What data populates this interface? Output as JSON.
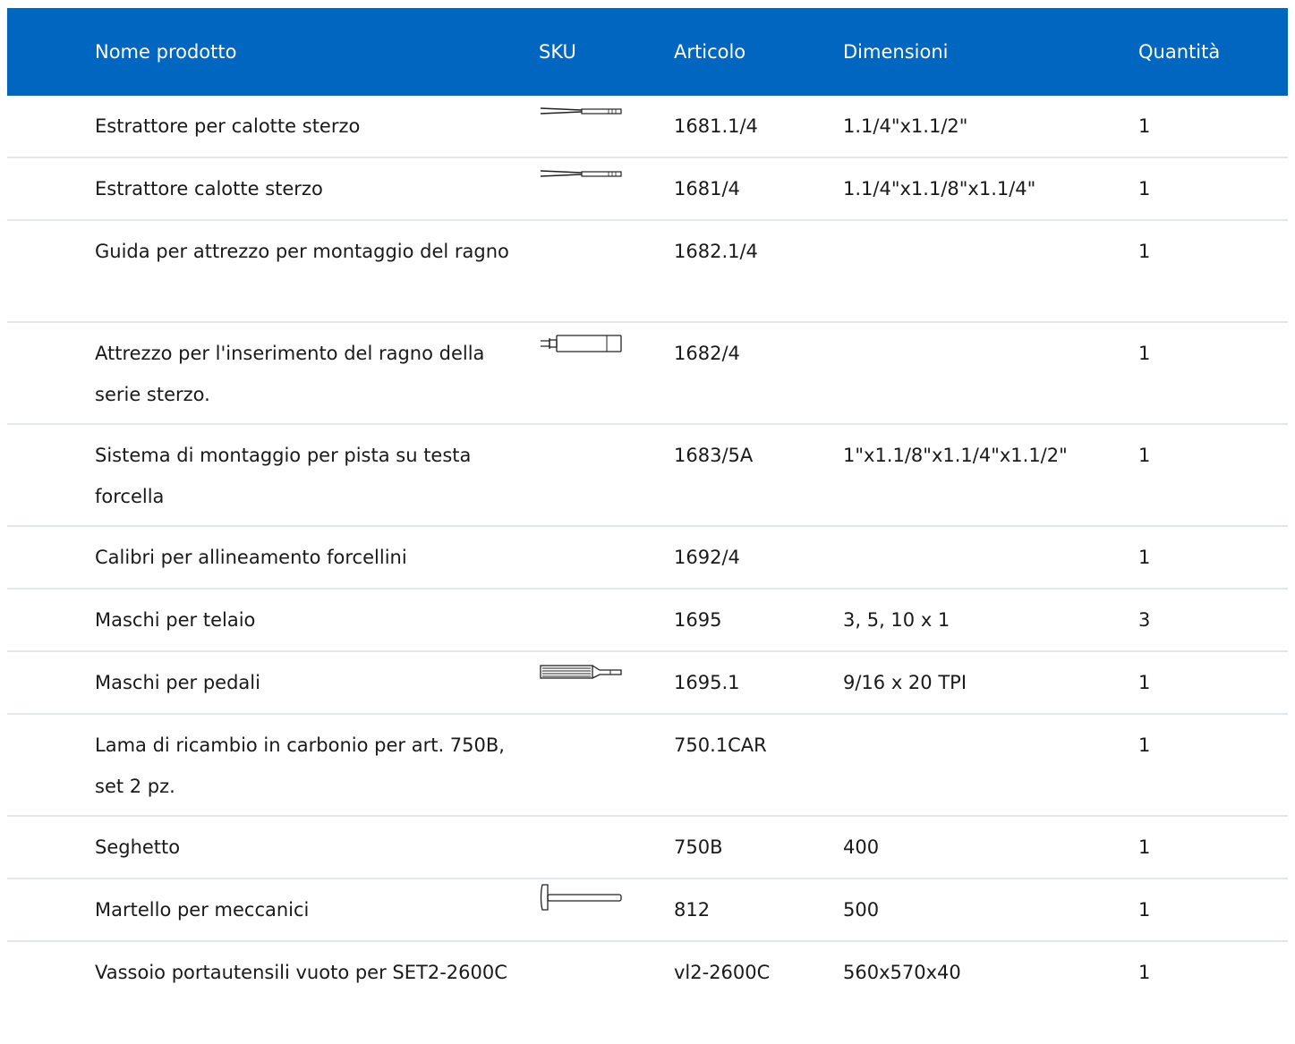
{
  "table": {
    "headers": {
      "name": "Nome prodotto",
      "sku": "SKU",
      "article": "Articolo",
      "dimensions": "Dimensioni",
      "quantity": "Quantità"
    },
    "rows": [
      {
        "name": "Estrattore per calotte sterzo",
        "sku_icon": "headset-cup-remover-icon",
        "article": "1681.1/4",
        "dimensions": "1.1/4\"x1.1/2\"",
        "quantity": "1"
      },
      {
        "name": "Estrattore calotte sterzo",
        "sku_icon": "headset-cup-remover-icon",
        "article": "1681/4",
        "dimensions": "1.1/4\"x1.1/8\"x1.1/4\"",
        "quantity": "1"
      },
      {
        "name": "Guida per attrezzo per montaggio del ragno",
        "sku_icon": "",
        "article": "1682.1/4",
        "dimensions": "",
        "quantity": "1"
      },
      {
        "name": "Attrezzo per l'inserimento del ragno della serie sterzo.",
        "sku_icon": "star-nut-setter-icon",
        "article": "1682/4",
        "dimensions": "",
        "quantity": "1"
      },
      {
        "name": "Sistema di montaggio per pista su testa forcella",
        "sku_icon": "",
        "article": "1683/5A",
        "dimensions": "1\"x1.1/8\"x1.1/4\"x1.1/2\"",
        "quantity": "1"
      },
      {
        "name": "Calibri per allineamento forcellini",
        "sku_icon": "",
        "article": "1692/4",
        "dimensions": "",
        "quantity": "1"
      },
      {
        "name": "Maschi per telaio",
        "sku_icon": "",
        "article": "1695",
        "dimensions": "3, 5, 10 x 1",
        "quantity": "3"
      },
      {
        "name": "Maschi per pedali",
        "sku_icon": "thread-tap-icon",
        "article": "1695.1",
        "dimensions": "9/16 x 20 TPI",
        "quantity": "1"
      },
      {
        "name": "Lama di ricambio in carbonio per art. 750B, set 2 pz.",
        "sku_icon": "",
        "article": "750.1CAR",
        "dimensions": "",
        "quantity": "1"
      },
      {
        "name": "Seghetto",
        "sku_icon": "",
        "article": "750B",
        "dimensions": "400",
        "quantity": "1"
      },
      {
        "name": "Martello per meccanici",
        "sku_icon": "hammer-icon",
        "article": "812",
        "dimensions": "500",
        "quantity": "1"
      },
      {
        "name": "Vassoio portautensili vuoto per SET2-2600C",
        "sku_icon": "",
        "article": "vl2-2600C",
        "dimensions": "560x570x40",
        "quantity": "1"
      }
    ]
  }
}
